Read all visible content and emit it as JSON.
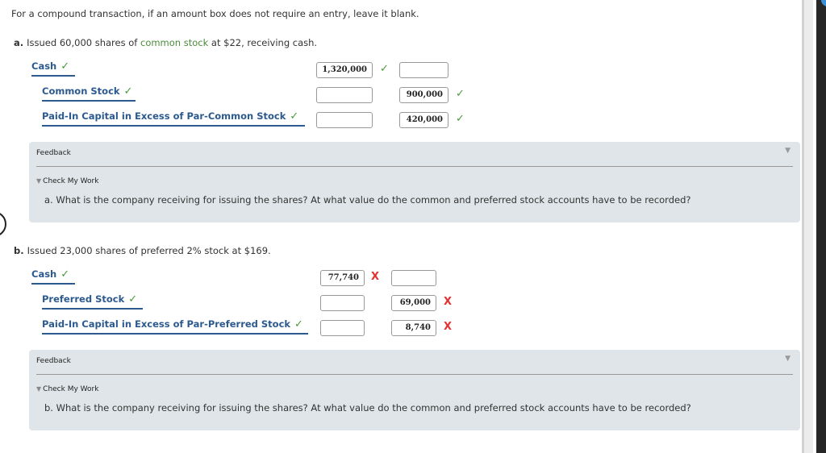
{
  "instructions": "For a compound transaction, if an amount box does not require an entry, leave it blank.",
  "colors": {
    "account_blue": "#2c5a8f",
    "correct_green": "#4a9a3a",
    "incorrect_red": "#e53030",
    "feedback_bg": "#dfe5e8"
  },
  "icons": {
    "correct": "✓",
    "incorrect": "X",
    "collapse": "▼"
  },
  "parts": [
    {
      "letter": "a.",
      "question_pre": "Issued 60,000 shares of ",
      "question_link": "common stock",
      "question_post": " at $22, receiving cash.",
      "entries": [
        {
          "account": "Cash",
          "account_status": "correct",
          "debit": "1,320,000",
          "debit_status": "correct",
          "credit": "",
          "credit_status": ""
        },
        {
          "account": "Common Stock",
          "account_status": "correct",
          "debit": "",
          "debit_status": "",
          "credit": "900,000",
          "credit_status": "correct"
        },
        {
          "account": "Paid-In Capital in Excess of Par-Common Stock",
          "account_status": "correct",
          "debit": "",
          "debit_status": "",
          "credit": "420,000",
          "credit_status": "correct"
        }
      ],
      "feedback": {
        "title": "Feedback",
        "check_label": "Check My Work",
        "text": "a. What is the company receiving for issuing the shares? At what value do the common and preferred stock accounts have to be recorded?"
      }
    },
    {
      "letter": "b.",
      "question_pre": "Issued 23,000 shares of preferred 2% stock at $169.",
      "question_link": "",
      "question_post": "",
      "entries": [
        {
          "account": "Cash",
          "account_status": "correct",
          "debit": "77,740",
          "debit_status": "incorrect",
          "credit": "",
          "credit_status": ""
        },
        {
          "account": "Preferred Stock",
          "account_status": "correct",
          "debit": "",
          "debit_status": "",
          "credit": "69,000",
          "credit_status": "incorrect"
        },
        {
          "account": "Paid-In Capital in Excess of Par-Preferred Stock",
          "account_status": "correct",
          "debit": "",
          "debit_status": "",
          "credit": "8,740",
          "credit_status": "incorrect"
        }
      ],
      "feedback": {
        "title": "Feedback",
        "check_label": "Check My Work",
        "text": "b. What is the company receiving for issuing the shares? At what value do the common and preferred stock accounts have to be recorded?"
      }
    }
  ]
}
